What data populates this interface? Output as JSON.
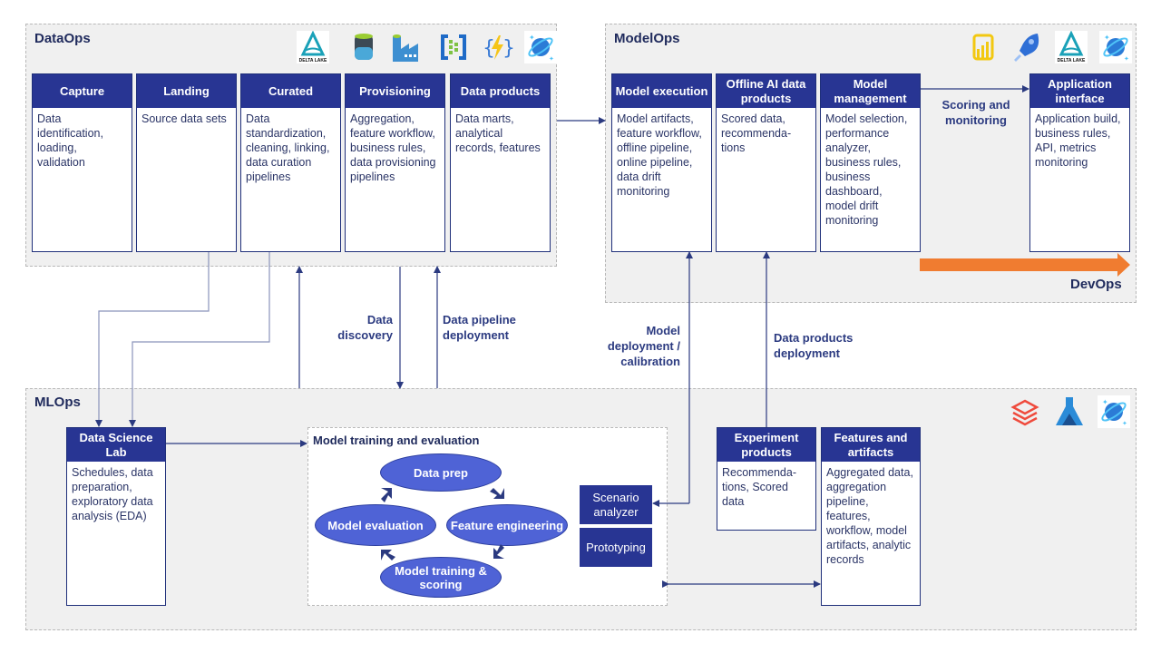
{
  "dataops": {
    "title": "DataOps",
    "icons": [
      "delta-lake-icon",
      "data-lake-storage-icon",
      "data-factory-icon",
      "event-hubs-icon",
      "functions-icon",
      "cosmos-db-icon"
    ],
    "delta_lake_text": "DELTA LAKE",
    "stages": [
      {
        "title": "Capture",
        "body": "Data identification, loading, validation"
      },
      {
        "title": "Landing",
        "body": "Source data sets"
      },
      {
        "title": "Curated",
        "body": "Data standardization, cleaning, linking, data curation pipelines"
      },
      {
        "title": "Provisioning",
        "body": "Aggregation, feature workflow, business rules, data provisioning pipelines"
      },
      {
        "title": "Data products",
        "body": "Data marts, analytical records, features"
      }
    ]
  },
  "modelops": {
    "title": "ModelOps",
    "icons": [
      "power-bi-icon",
      "azure-devops-icon",
      "delta-lake-icon",
      "cosmos-db-icon"
    ],
    "delta_lake_text": "DELTA LAKE",
    "stages": [
      {
        "title": "Model execution",
        "body": "Model artifacts, feature workflow, offline pipeline, online pipeline, data drift monitoring"
      },
      {
        "title": "Offline AI data products",
        "body": "Scored data, recommenda-tions"
      },
      {
        "title": "Model management",
        "body": "Model selection, performance analyzer, business rules, business dashboard, model drift monitoring"
      },
      {
        "title": "Application interface",
        "body": "Application build, business rules, API, metrics monitoring"
      }
    ],
    "scoring_label": "Scoring and monitoring",
    "devops_label": "DevOps",
    "devops_color": "#f07c30"
  },
  "connectors": {
    "data_discovery": "Data discovery",
    "data_pipeline_deployment": "Data pipeline deployment",
    "model_deployment": "Model deployment / calibration",
    "data_products_deployment": "Data products deployment"
  },
  "mlops": {
    "title": "MLOps",
    "icons": [
      "databricks-icon",
      "azure-ml-icon",
      "cosmos-db-icon"
    ],
    "lab": {
      "title": "Data Science Lab",
      "body": "Schedules, data preparation, exploratory data analysis (EDA)"
    },
    "training": {
      "title": "Model training and evaluation",
      "cycle": [
        "Data prep",
        "Feature engineering",
        "Model training & scoring",
        "Model evaluation"
      ],
      "tools": [
        "Scenario analyzer",
        "Prototyping"
      ]
    },
    "experiment": {
      "title": "Experiment products",
      "body": "Recommenda-tions, Scored data"
    },
    "features": {
      "title": "Features and artifacts",
      "body": "Aggregated data, aggregation pipeline, features, workflow,  model artifacts, analytic records"
    }
  },
  "colors": {
    "navy": "#283593",
    "ellipse": "#4f63d6",
    "panel": "#f0f0f0",
    "devops_arrow": "#f07c30"
  }
}
